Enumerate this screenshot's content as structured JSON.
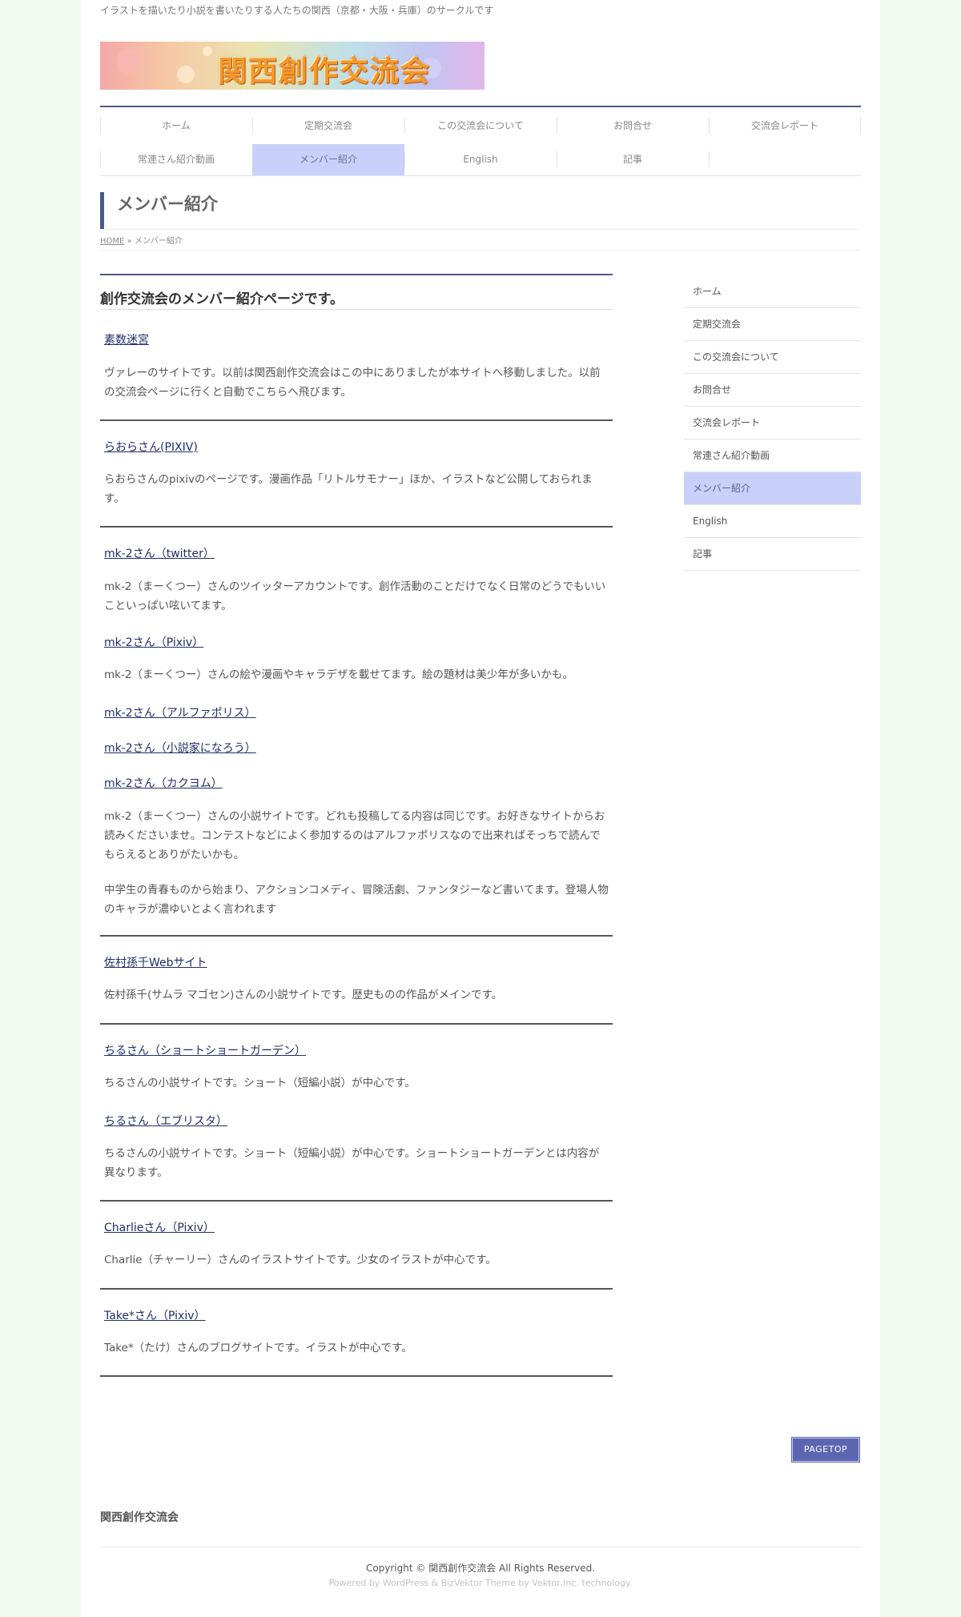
{
  "header": {
    "tagline": "イラストを描いたり小説を書いたりする人たちの関西（京都・大阪・兵庫）のサークルです",
    "logo_text": "関西創作交流会"
  },
  "nav": {
    "items": [
      {
        "label": "ホーム"
      },
      {
        "label": "定期交流会"
      },
      {
        "label": "この交流会について"
      },
      {
        "label": "お問合せ"
      },
      {
        "label": "交流会レポート"
      },
      {
        "label": "常連さん紹介動画"
      },
      {
        "label": "メンバー紹介",
        "active": true
      },
      {
        "label": "English"
      },
      {
        "label": "記事"
      }
    ]
  },
  "page": {
    "title": "メンバー紹介",
    "breadcrumb_home": "HOME",
    "breadcrumb_sep": "»",
    "breadcrumb_current": "メンバー紹介"
  },
  "content": {
    "heading": "創作交流会のメンバー紹介ページです。",
    "entries": [
      {
        "link": "素数迷宮",
        "desc": "ヴァレーのサイトです。以前は関西創作交流会はこの中にありましたが本サイトへ移動しました。以前の交流会ページに行くと自動でこちらへ飛びます。"
      },
      {
        "link": "らおらさん(PIXIV)",
        "desc": "らおらさんのpixivのページです。漫画作品「リトルサモナー」ほか、イラストなど公開しておられます。"
      },
      {
        "link": "mk-2さん（twitter）",
        "desc": "mk-2（まーくつー）さんのツイッターアカウントです。創作活動のことだけでなく日常のどうでもいいこといっぱい呟いてます。"
      },
      {
        "link": "mk-2さん（Pixiv）",
        "desc": "mk-2（まーくつー）さんの絵や漫画やキャラデザを載せてます。絵の題材は美少年が多いかも。"
      },
      {
        "link": "mk-2さん（アルファポリス）"
      },
      {
        "link": "mk-2さん（小説家になろう）"
      },
      {
        "link": "mk-2さん（カクヨム）",
        "desc": "mk-2（まーくつー）さんの小説サイトです。どれも投稿してる内容は同じです。お好きなサイトからお読みくださいませ。コンテストなどによく参加するのはアルファポリスなので出来ればそっちで読んでもらえるとありがたいかも。",
        "desc2": "中学生の青春ものから始まり、アクションコメディ、冒険活劇、ファンタジーなど書いてます。登場人物のキャラが濃ゆいとよく言われます"
      },
      {
        "link": "佐村孫千Webサイト",
        "desc": "佐村孫千(サムラ マゴセン)さんの小説サイトです。歴史ものの作品がメインです。"
      },
      {
        "link": "ちるさん（ショートショートガーデン）",
        "desc": "ちるさんの小説サイトです。ショート（短編小説）が中心です。"
      },
      {
        "link": "ちるさん（エブリスタ）",
        "desc": "ちるさんの小説サイトです。ショート（短編小説）が中心です。ショートショートガーデンとは内容が異なります。"
      },
      {
        "link": "Charlieさん（Pixiv）",
        "desc": "Charlie（チャーリー）さんのイラストサイトです。少女のイラストが中心です。"
      },
      {
        "link": "Take*さん（Pixiv）",
        "desc": "Take*（たけ）さんのブログサイトです。イラストが中心です。"
      }
    ]
  },
  "sidebar": {
    "items": [
      {
        "label": "ホーム"
      },
      {
        "label": "定期交流会"
      },
      {
        "label": "この交流会について"
      },
      {
        "label": "お問合せ"
      },
      {
        "label": "交流会レポート"
      },
      {
        "label": "常連さん紹介動画"
      },
      {
        "label": "メンバー紹介",
        "active": true
      },
      {
        "label": "English"
      },
      {
        "label": "記事"
      }
    ]
  },
  "footer": {
    "pagetop": "PAGETOP",
    "site_name": "関西創作交流会",
    "copyright": "Copyright © 関西創作交流会 All Rights Reserved.",
    "powered": "Powered by WordPress & BizVektor Theme by Vektor,Inc. technology."
  },
  "colors": {
    "accent": "#4a5a8a",
    "active_bg": "#c9d1fb",
    "link": "#1f2e6b",
    "page_bg": "#f0fbf0",
    "pagetop_bg": "#5b65b0"
  }
}
